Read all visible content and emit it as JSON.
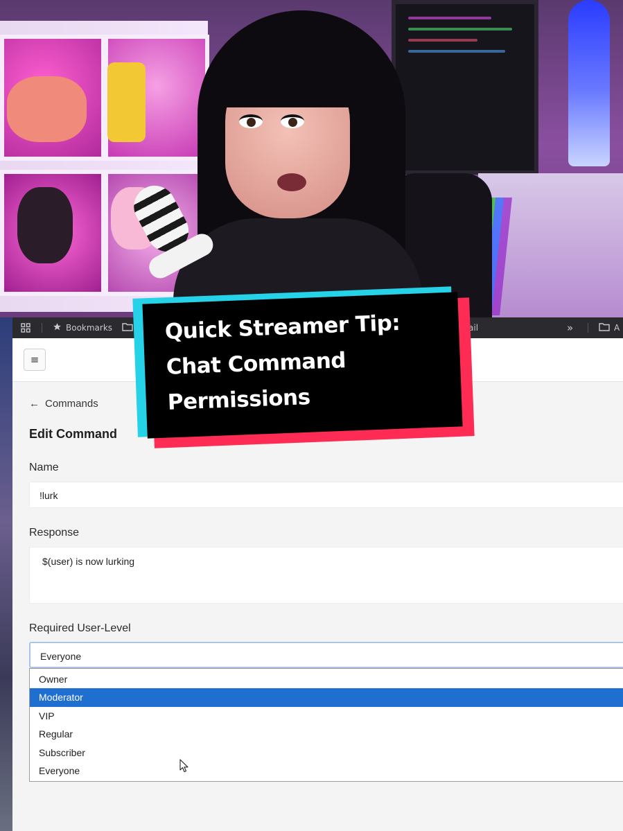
{
  "overlay": {
    "caption_lines": [
      "Quick Streamer Tip:",
      "Chat Command",
      "Permissions"
    ],
    "colors": {
      "box": "#000000",
      "cyan": "#25d2e8",
      "red": "#fe2c55",
      "text": "#ffffff"
    }
  },
  "browser": {
    "bookmarks_bar": {
      "apps_icon": "apps-grid-icon",
      "items": [
        {
          "icon": "star-icon",
          "label": "Bookmarks"
        },
        {
          "icon": "folder-icon",
          "label": ""
        },
        {
          "icon": "folder-icon",
          "label": "ail"
        }
      ],
      "overflow": "»",
      "trailing_folder_label": "A"
    },
    "menu_button": {
      "icon": "hamburger-menu-icon",
      "glyph": "≡"
    }
  },
  "edit_command": {
    "back_arrow": "←",
    "back_label": "Commands",
    "title": "Edit Command",
    "name_label": "Name",
    "name_value": "!lurk",
    "response_label": "Response",
    "response_value": "$(user) is now lurking",
    "user_level_label": "Required User-Level",
    "user_level_value": "Everyone",
    "user_level_options": [
      "Owner",
      "Moderator",
      "VIP",
      "Regular",
      "Subscriber",
      "Everyone"
    ],
    "highlighted_option": "Moderator",
    "accent_color": "#1f6fd1"
  }
}
